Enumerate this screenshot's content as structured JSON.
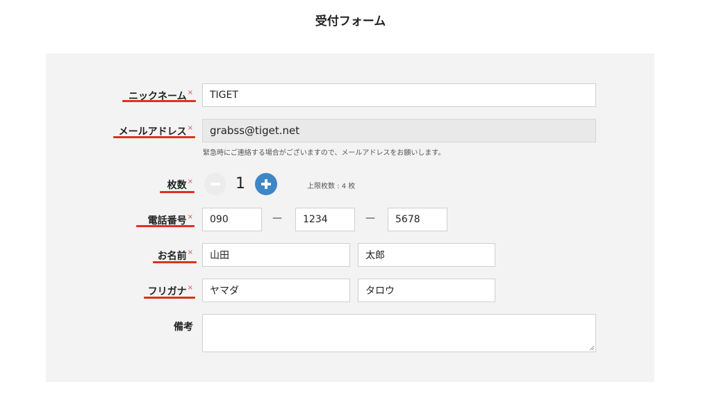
{
  "page": {
    "title": "受付フォーム"
  },
  "form": {
    "required_mark": "×",
    "nickname": {
      "label": "ニックネーム",
      "value": "TIGET"
    },
    "email": {
      "label": "メールアドレス",
      "value": "grabss@tiget.net",
      "hint": "緊急時にご連絡する場合がございますので、メールアドレスをお願いします。"
    },
    "quantity": {
      "label": "枚数",
      "value": "1",
      "limit_text": "上限枚数 : 4 枚"
    },
    "phone": {
      "label": "電話番号",
      "part1": "090",
      "part2": "1234",
      "part3": "5678",
      "separator": "—"
    },
    "name": {
      "label": "お名前",
      "last": "山田",
      "first": "太郎"
    },
    "furigana": {
      "label": "フリガナ",
      "last": "ヤマダ",
      "first": "タロウ"
    },
    "remarks": {
      "label": "備考",
      "value": ""
    }
  },
  "colors": {
    "panel_bg": "#f3f3f3",
    "required": "#d9534f",
    "underline": "#e0301e",
    "plus_button": "#3f86c7"
  },
  "icons": {
    "minus": "minus-circle-icon",
    "plus": "plus-circle-icon"
  }
}
